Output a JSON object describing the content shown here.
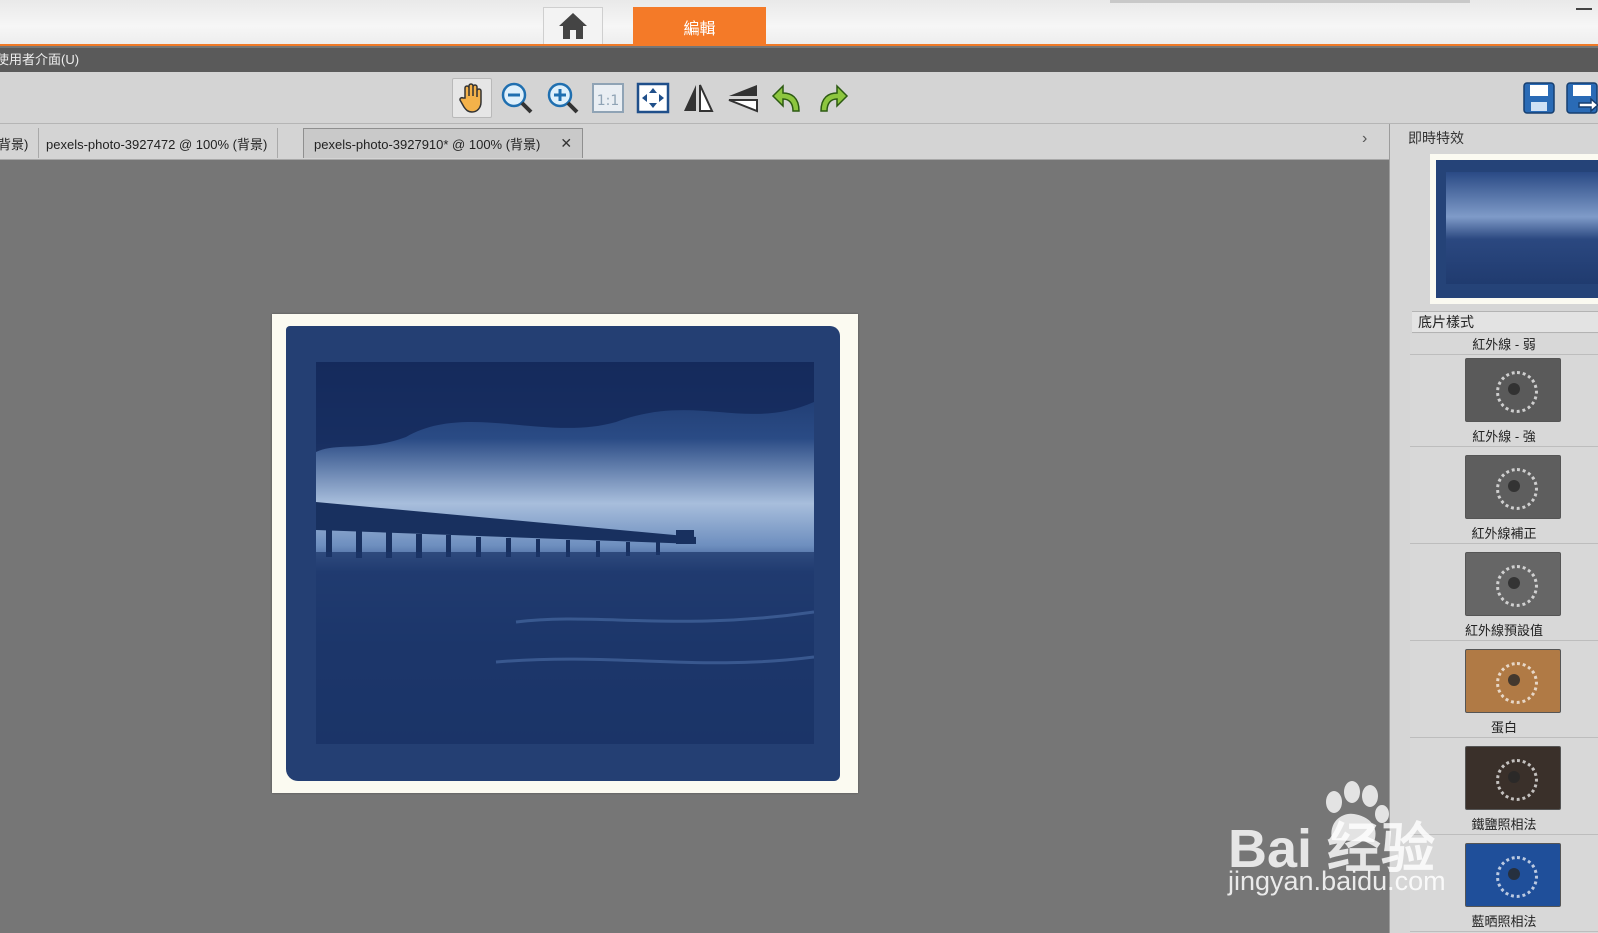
{
  "header": {
    "edit_tab": "編輯"
  },
  "menubar": {
    "label": "使用者介面(U)"
  },
  "toolbar": {
    "tools": [
      "hand-icon",
      "zoom-out-icon",
      "zoom-in-icon",
      "actual-size-icon",
      "fit-screen-icon",
      "flip-horizontal-icon",
      "flip-vertical-icon",
      "rotate-left-icon",
      "rotate-right-icon"
    ],
    "actual_size_label": "1:1"
  },
  "tabs": [
    {
      "label": "背景)"
    },
    {
      "label": "pexels-photo-3927472 @ 100% (背景)"
    },
    {
      "label": "pexels-photo-3927910* @ 100% (背景)",
      "active": true,
      "close": "✕"
    }
  ],
  "right_panel": {
    "title": "即時特效",
    "section": "底片樣式",
    "items": [
      {
        "label": "紅外線 - 弱",
        "tone": "gray"
      },
      {
        "label": "紅外線 - 強",
        "tone": "gray"
      },
      {
        "label": "紅外線補正",
        "tone": "gray"
      },
      {
        "label": "紅外線預設值",
        "tone": "gray"
      },
      {
        "label": "蛋白",
        "tone": "sepia"
      },
      {
        "label": "鐵鹽照相法",
        "tone": "dark"
      },
      {
        "label": "藍晒照相法",
        "tone": "blue"
      }
    ]
  },
  "watermark": {
    "brand": "Bai 经验",
    "url": "jingyan.baidu.com"
  },
  "colors": {
    "accent": "#f47a28",
    "menubar": "#5a5a5a",
    "canvas": "#767676",
    "photo_blue": "#243f73"
  }
}
